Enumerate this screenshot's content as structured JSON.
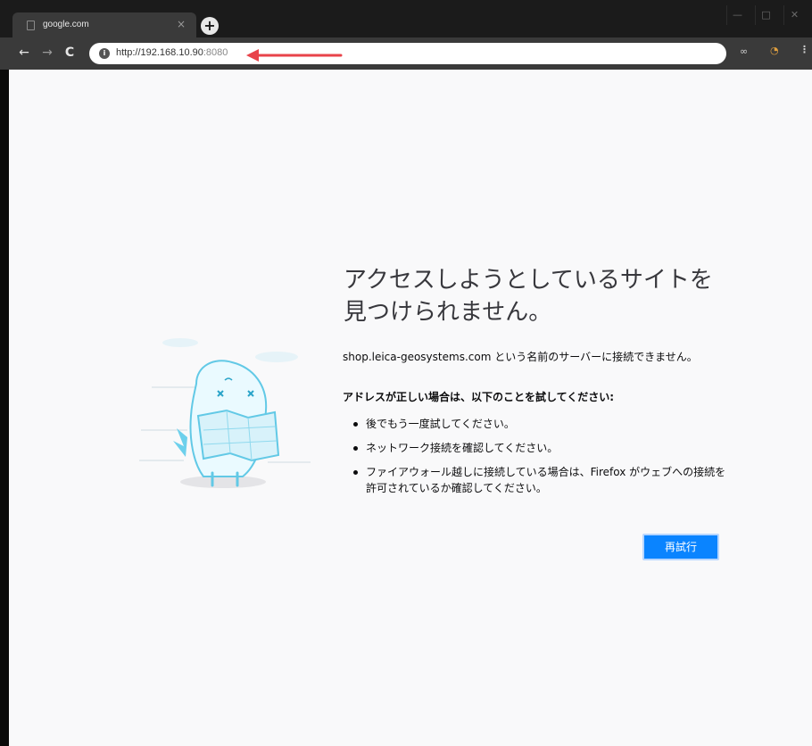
{
  "browser": {
    "tab": {
      "title": "google.com",
      "close": "×"
    },
    "new_tab": "+",
    "window_controls": {
      "minimize": "—",
      "maximize": "□",
      "close": "✕"
    },
    "nav": {
      "back": "←",
      "forward": "→",
      "reload": "C"
    },
    "address_bar": {
      "info": "i",
      "url_main": "http://192.168.10.90",
      "url_port": ":8080"
    },
    "toolbar_extras": {
      "ext1": "∞",
      "ext2": "◔",
      "menu": "⋮"
    }
  },
  "error_page": {
    "title": "アクセスしようとしているサイトを見つけられません。",
    "description": "shop.leica-geosystems.com という名前のサーバーに接続できません。",
    "advice_heading": "アドレスが正しい場合は、以下のことを試してください:",
    "suggestions": [
      "後でもう一度試してください。",
      "ネットワーク接続を確認してください。",
      "ファイアウォール越しに接続している場合は、Firefox がウェブへの接続を許可されているか確認してください。"
    ],
    "retry_button": "再試行"
  },
  "colors": {
    "accent_button": "#0a84ff",
    "annotation_arrow": "#e8434a",
    "illustration": "#62c9e6"
  },
  "icons": [
    "info-icon",
    "back-arrow-icon",
    "forward-arrow-icon",
    "reload-icon",
    "dinosaur-illustration",
    "annotation-arrow-icon"
  ]
}
